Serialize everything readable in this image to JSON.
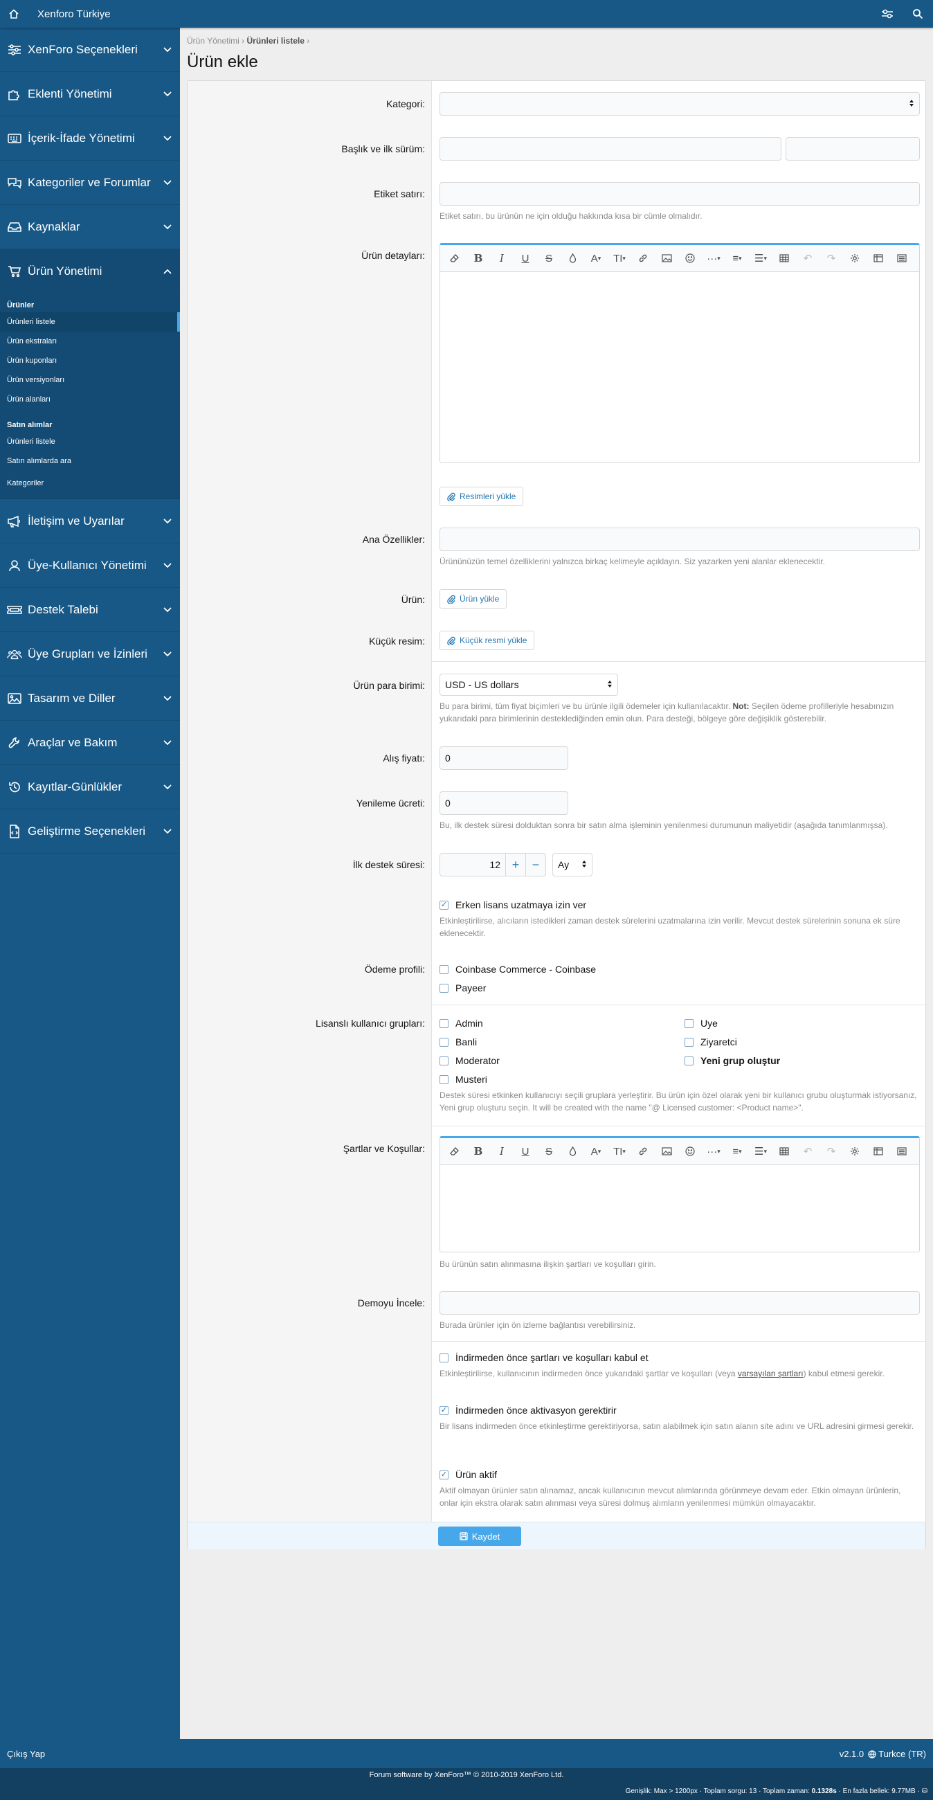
{
  "topbar": {
    "brand": "Xenforo Türkiye",
    "home_icon": "home-icon",
    "tools_icon": "settings-tools-icon",
    "search_icon": "search-icon"
  },
  "sidebar": {
    "sections_top": [
      {
        "label": "XenForo Seçenekleri",
        "icon": "sliders-icon"
      },
      {
        "label": "Eklenti Yönetimi",
        "icon": "puzzle-icon"
      },
      {
        "label": "İçerik-İfade Yönetimi",
        "icon": "keyboard-icon"
      },
      {
        "label": "Kategoriler ve Forumlar",
        "icon": "comments-icon"
      },
      {
        "label": "Kaynaklar",
        "icon": "inbox-icon"
      }
    ],
    "open_section": {
      "label": "Ürün Yönetimi",
      "icon": "cart-icon"
    },
    "sub_header1": "Ürünler",
    "sub_items1": [
      "Ürünleri listele",
      "Ürün ekstraları",
      "Ürün kuponları",
      "Ürün versiyonları",
      "Ürün alanları"
    ],
    "sub_header2": "Satın alımlar",
    "sub_items2": [
      "Ürünleri listele",
      "Satın alımlarda ara"
    ],
    "sub_category": "Kategoriler",
    "sections_bottom": [
      {
        "label": "İletişim ve Uyarılar",
        "icon": "megaphone-icon"
      },
      {
        "label": "Üye-Kullanıcı Yönetimi",
        "icon": "user-icon"
      },
      {
        "label": "Destek Talebi",
        "icon": "ticket-icon"
      },
      {
        "label": "Üye Grupları ve İzinleri",
        "icon": "users-icon"
      },
      {
        "label": "Tasarım ve Diller",
        "icon": "image-icon"
      },
      {
        "label": "Araçlar ve Bakım",
        "icon": "wrench-icon"
      },
      {
        "label": "Kayıtlar-Günlükler",
        "icon": "history-icon"
      },
      {
        "label": "Geliştirme Seçenekleri",
        "icon": "file-code-icon"
      }
    ]
  },
  "breadcrumb": {
    "item1": "Ürün Yönetimi",
    "item2": "Ürünleri listele",
    "sep": "›"
  },
  "page_title": "Ürün ekle",
  "form": {
    "category_label": "Kategori:",
    "category_value": "",
    "title_label": "Başlık ve ilk sürüm:",
    "title_value": "",
    "version_value": "",
    "tagline_label": "Etiket satırı:",
    "tagline_value": "",
    "tagline_hint": "Etiket satırı, bu ürünün ne için olduğu hakkında kısa bir cümle olmalıdır.",
    "details_label": "Ürün detayları:",
    "upload_images": "Resimleri yükle",
    "features_label": "Ana Özellikler:",
    "features_value": "",
    "features_hint": "Ürününüzün temel özelliklerini yalnızca birkaç kelimeyle açıklayın. Siz yazarken yeni alanlar eklenecektir.",
    "product_label": "Ürün:",
    "product_upload": "Ürün yükle",
    "thumb_label": "Küçük resim:",
    "thumb_upload": "Küçük resmi yükle",
    "currency_label": "Ürün para birimi:",
    "currency_value": "USD - US dollars",
    "currency_hint_pre": "Bu para birimi, tüm fiyat biçimleri ve bu ürünle ilgili ödemeler için kullanılacaktır.",
    "currency_hint_bold": "Not:",
    "currency_hint_post": "Seçilen ödeme profilleriyle hesabınızın yukarıdaki para birimlerinin desteklediğinden emin olun. Para desteği, bölgeye göre değişiklik gösterebilir.",
    "price_label": "Alış fiyatı:",
    "price_value": "0",
    "renewal_label": "Yenileme ücreti:",
    "renewal_value": "0",
    "renewal_hint": "Bu, ilk destek süresi dolduktan sonra bir satın alma işleminin yenilenmesi durumunun maliyetidir (aşağıda tanımlanmışsa).",
    "support_label": "İlk destek süresi:",
    "support_value": "12",
    "support_plus": "+",
    "support_minus": "−",
    "support_unit": "Ay",
    "early_label": "Erken lisans uzatmaya izin ver",
    "early_hint": "Etkinleştirilirse, alıcıların istedikleri zaman destek sürelerini uzatmalarına izin verilir. Mevcut destek sürelerinin sonuna ek süre eklenecektir.",
    "payment_label": "Ödeme profili:",
    "payment_options": [
      "Coinbase Commerce - Coinbase",
      "Payeer"
    ],
    "groups_label": "Lisanslı kullanıcı grupları:",
    "groups_left": [
      "Admin",
      "Banli",
      "Moderator",
      "Musteri"
    ],
    "groups_right": [
      "Uye",
      "Ziyaretci"
    ],
    "groups_new": "Yeni grup oluştur",
    "groups_hint": "Destek süresi etkinken kullanıcıyı seçili gruplara yerleştirir. Bu ürün için özel olarak yeni bir kullanıcı grubu oluşturmak istiyorsanız, Yeni grup oluşturu seçin. It will be created with the name \"@ Licensed customer: <Product name>\".",
    "terms_label": "Şartlar ve Koşullar:",
    "terms_hint": "Bu ürünün satın alınmasına ilişkin şartları ve koşulları girin.",
    "demo_label": "Demoyu İncele:",
    "demo_value": "",
    "demo_hint": "Burada ürünler için ön izleme bağlantısı verebilirsiniz.",
    "accept_label": "İndirmeden önce şartları ve koşulları kabul et",
    "accept_hint_pre": "Etkinleştirilirse, kullanıcının indirmeden önce yukarıdaki şartlar ve koşulları (veya",
    "accept_hint_link": "varsayılan şartları",
    "accept_hint_post": ") kabul etmesi gerekir.",
    "activation_label": "İndirmeden önce aktivasyon gerektirir",
    "activation_hint": "Bir lisans indirmeden önce etkinleştirme gerektiriyorsa, satın alabilmek için satın alanın site adını ve URL adresini girmesi gerekir.",
    "active_label": "Ürün aktif",
    "active_hint": "Aktif olmayan ürünler satın alınamaz, ancak kullanıcının mevcut alımlarında görünmeye devam eder. Etkin olmayan ürünlerin, onlar için ekstra olarak satın alınması veya süresi dolmuş alımların yenilenmesi mümkün olmayacaktır.",
    "save": "Kaydet"
  },
  "footer": {
    "logout": "Çıkış Yap",
    "version": "v2.1.0",
    "language": "Turkce (TR)",
    "copyright": "Forum software by XenForo™ © 2010-2019 XenForo Ltd.",
    "stats_pre": "Genişlik: Max > 1200px · Toplam sorgu: 13 · Toplam zaman:",
    "stats_time": "0.1328s",
    "stats_post": "· En fazla bellek: 9.77MB ·"
  }
}
